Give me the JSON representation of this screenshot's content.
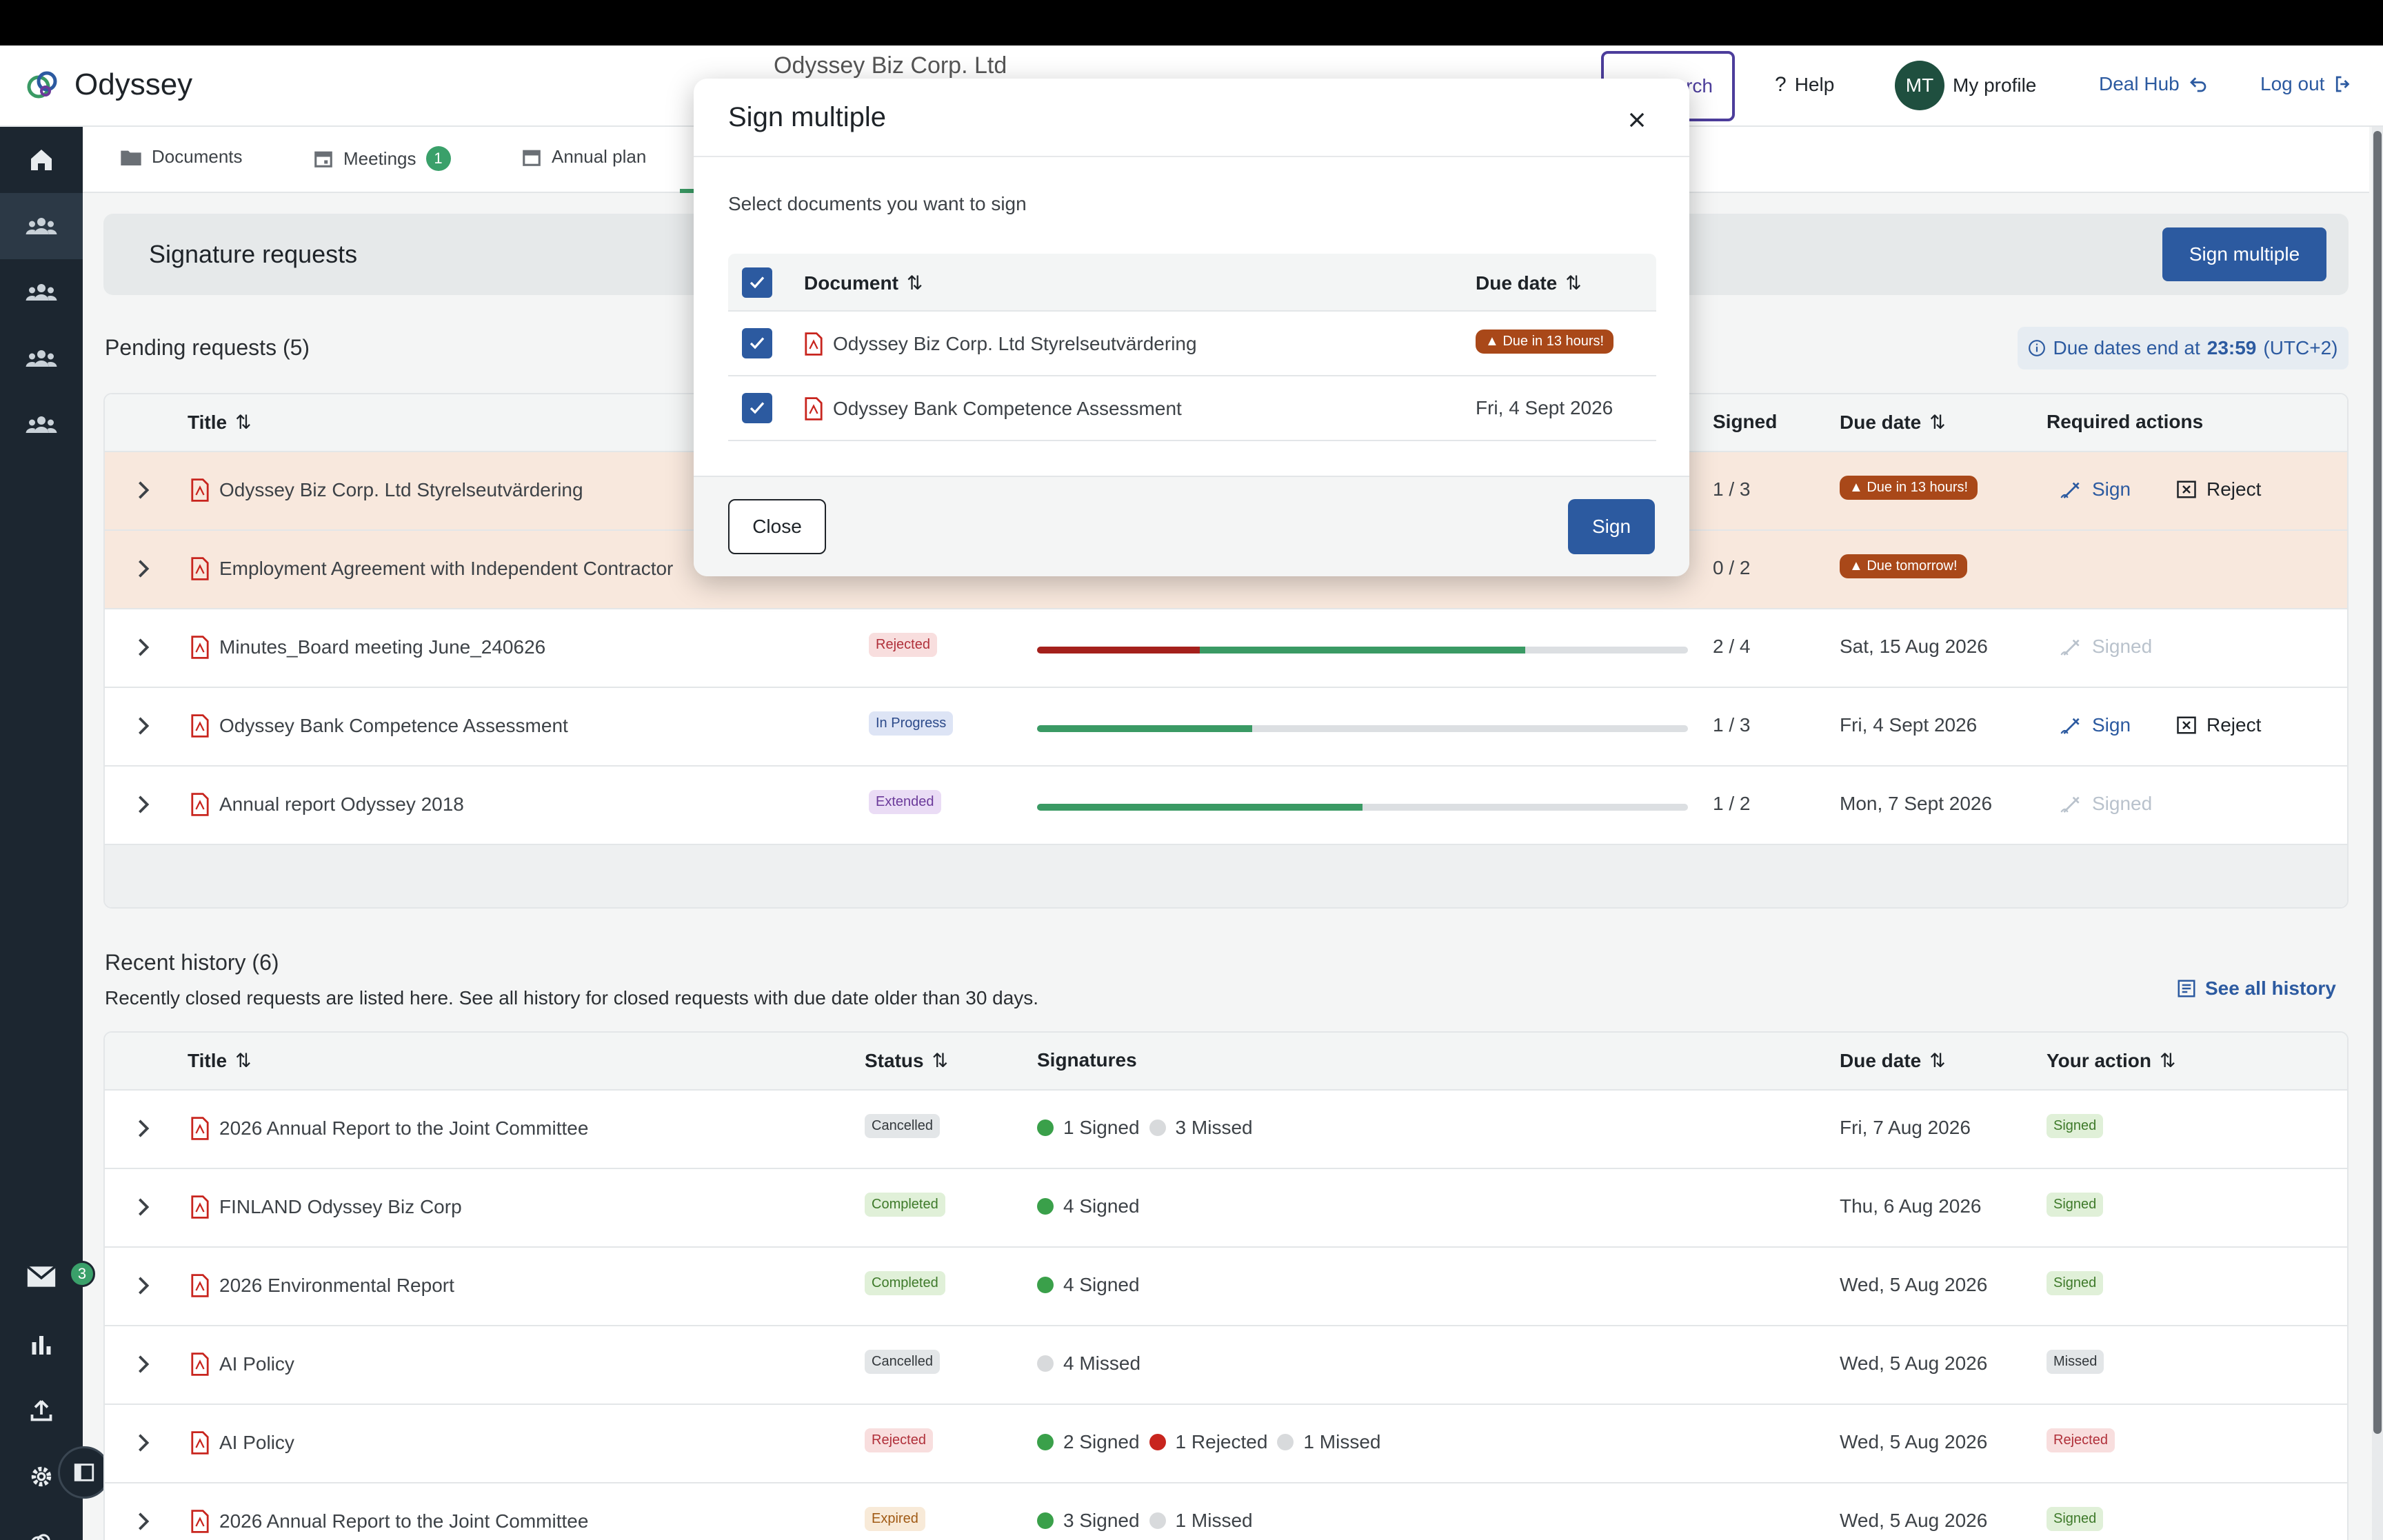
{
  "app": {
    "name": "Odyssey",
    "company": "Odyssey Biz Corp. Ltd"
  },
  "header": {
    "search_label": "rch",
    "help_label": "Help",
    "avatar_initials": "MT",
    "profile_label": "My profile",
    "deal_hub_label": "Deal Hub",
    "logout_label": "Log out"
  },
  "sidebar": {
    "mail_badge": "3"
  },
  "tabs": [
    {
      "label": "Documents"
    },
    {
      "label": "Meetings",
      "badge": "1"
    },
    {
      "label": "Annual plan"
    }
  ],
  "signature_requests": {
    "title": "Signature requests",
    "sign_multiple_label": "Sign multiple"
  },
  "pending": {
    "title": "Pending requests (5)",
    "due_info_prefix": "Due dates end at",
    "due_info_time": "23:59",
    "due_info_tz": "(UTC+2)",
    "headers": {
      "title": "Title",
      "signed": "Signed",
      "due_date": "Due date",
      "actions": "Required actions"
    },
    "rows": [
      {
        "title": "Odyssey Biz Corp. Ltd Styrelseutvärdering",
        "status": "",
        "signed": "1 / 3",
        "due": "Due in 13 hours!",
        "sign": "Sign",
        "reject": "Reject"
      },
      {
        "title": "Employment Agreement with Independent Contractor",
        "status": "",
        "signed": "0 / 2",
        "due": "Due tomorrow!",
        "sign": "",
        "reject": ""
      },
      {
        "title": "Minutes_Board meeting June_240626",
        "status": "Rejected",
        "signed": "2 / 4",
        "due": "Sat, 15 Aug 2026",
        "sign": "Signed",
        "reject": "",
        "progress_red": 0.25,
        "progress_green": 0.5
      },
      {
        "title": "Odyssey Bank Competence Assessment",
        "status": "In Progress",
        "signed": "1 / 3",
        "due": "Fri, 4 Sept 2026",
        "sign": "Sign",
        "reject": "Reject",
        "progress_red": 0,
        "progress_green": 0.33
      },
      {
        "title": "Annual report Odyssey 2018",
        "status": "Extended",
        "signed": "1 / 2",
        "due": "Mon, 7 Sept 2026",
        "sign": "Signed",
        "reject": "",
        "progress_red": 0,
        "progress_green": 0.5
      }
    ]
  },
  "history": {
    "title": "Recent history (6)",
    "subtitle": "Recently closed requests are listed here. See all history for closed requests with due date older than 30 days.",
    "see_all_label": "See all history",
    "headers": {
      "title": "Title",
      "status": "Status",
      "signatures": "Signatures",
      "due_date": "Due date",
      "action": "Your action"
    },
    "rows": [
      {
        "title": "2026 Annual Report to the Joint Committee",
        "status": "Cancelled",
        "sig1": "1 Signed",
        "sig2": "3 Missed",
        "sig3": "",
        "due": "Fri, 7 Aug 2026",
        "action": "Signed"
      },
      {
        "title": "FINLAND Odyssey Biz Corp",
        "status": "Completed",
        "sig1": "4 Signed",
        "sig2": "",
        "sig3": "",
        "due": "Thu, 6 Aug 2026",
        "action": "Signed"
      },
      {
        "title": "2026 Environmental Report",
        "status": "Completed",
        "sig1": "4 Signed",
        "sig2": "",
        "sig3": "",
        "due": "Wed, 5 Aug 2026",
        "action": "Signed"
      },
      {
        "title": "AI Policy",
        "status": "Cancelled",
        "sig1": "4 Missed",
        "sig2": "",
        "sig3": "",
        "due": "Wed, 5 Aug 2026",
        "action": "Missed"
      },
      {
        "title": "AI Policy",
        "status": "Rejected",
        "sig1": "2 Signed",
        "sig2": "1 Rejected",
        "sig3": "1 Missed",
        "due": "Wed, 5 Aug 2026",
        "action": "Rejected"
      },
      {
        "title": "2026 Annual Report to the Joint Committee",
        "status": "Expired",
        "sig1": "3 Signed",
        "sig2": "1 Missed",
        "sig3": "",
        "due": "Wed, 5 Aug 2026",
        "action": "Signed"
      }
    ]
  },
  "modal": {
    "title": "Sign multiple",
    "subtitle": "Select documents you want to sign",
    "headers": {
      "document": "Document",
      "due_date": "Due date"
    },
    "rows": [
      {
        "document": "Odyssey Biz Corp. Ltd Styrelseutvärdering",
        "due": "Due in 13 hours!"
      },
      {
        "document": "Odyssey Bank Competence Assessment",
        "due": "Fri, 4 Sept 2026"
      }
    ],
    "close_label": "Close",
    "sign_label": "Sign"
  },
  "colors": {
    "primary": "#2c5aa0",
    "sidebar": "#1c2630",
    "due_badge": "#a94819",
    "success": "#3a9a64",
    "danger": "#a4201c"
  }
}
